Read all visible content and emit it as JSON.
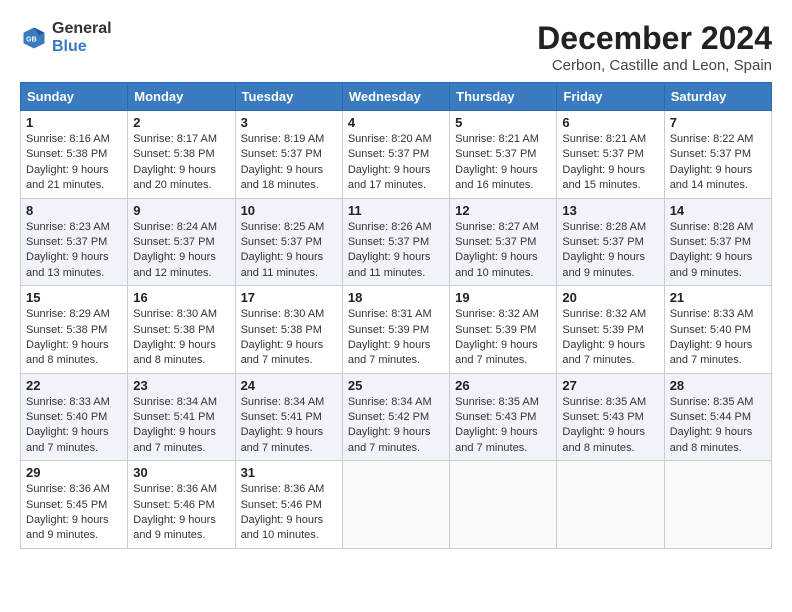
{
  "header": {
    "logo": {
      "line1": "General",
      "line2": "Blue"
    },
    "title": "December 2024",
    "subtitle": "Cerbon, Castille and Leon, Spain"
  },
  "weekdays": [
    "Sunday",
    "Monday",
    "Tuesday",
    "Wednesday",
    "Thursday",
    "Friday",
    "Saturday"
  ],
  "weeks": [
    [
      {
        "day": "1",
        "info": "Sunrise: 8:16 AM\nSunset: 5:38 PM\nDaylight: 9 hours\nand 21 minutes."
      },
      {
        "day": "2",
        "info": "Sunrise: 8:17 AM\nSunset: 5:38 PM\nDaylight: 9 hours\nand 20 minutes."
      },
      {
        "day": "3",
        "info": "Sunrise: 8:19 AM\nSunset: 5:37 PM\nDaylight: 9 hours\nand 18 minutes."
      },
      {
        "day": "4",
        "info": "Sunrise: 8:20 AM\nSunset: 5:37 PM\nDaylight: 9 hours\nand 17 minutes."
      },
      {
        "day": "5",
        "info": "Sunrise: 8:21 AM\nSunset: 5:37 PM\nDaylight: 9 hours\nand 16 minutes."
      },
      {
        "day": "6",
        "info": "Sunrise: 8:21 AM\nSunset: 5:37 PM\nDaylight: 9 hours\nand 15 minutes."
      },
      {
        "day": "7",
        "info": "Sunrise: 8:22 AM\nSunset: 5:37 PM\nDaylight: 9 hours\nand 14 minutes."
      }
    ],
    [
      {
        "day": "8",
        "info": "Sunrise: 8:23 AM\nSunset: 5:37 PM\nDaylight: 9 hours\nand 13 minutes."
      },
      {
        "day": "9",
        "info": "Sunrise: 8:24 AM\nSunset: 5:37 PM\nDaylight: 9 hours\nand 12 minutes."
      },
      {
        "day": "10",
        "info": "Sunrise: 8:25 AM\nSunset: 5:37 PM\nDaylight: 9 hours\nand 11 minutes."
      },
      {
        "day": "11",
        "info": "Sunrise: 8:26 AM\nSunset: 5:37 PM\nDaylight: 9 hours\nand 11 minutes."
      },
      {
        "day": "12",
        "info": "Sunrise: 8:27 AM\nSunset: 5:37 PM\nDaylight: 9 hours\nand 10 minutes."
      },
      {
        "day": "13",
        "info": "Sunrise: 8:28 AM\nSunset: 5:37 PM\nDaylight: 9 hours\nand 9 minutes."
      },
      {
        "day": "14",
        "info": "Sunrise: 8:28 AM\nSunset: 5:37 PM\nDaylight: 9 hours\nand 9 minutes."
      }
    ],
    [
      {
        "day": "15",
        "info": "Sunrise: 8:29 AM\nSunset: 5:38 PM\nDaylight: 9 hours\nand 8 minutes."
      },
      {
        "day": "16",
        "info": "Sunrise: 8:30 AM\nSunset: 5:38 PM\nDaylight: 9 hours\nand 8 minutes."
      },
      {
        "day": "17",
        "info": "Sunrise: 8:30 AM\nSunset: 5:38 PM\nDaylight: 9 hours\nand 7 minutes."
      },
      {
        "day": "18",
        "info": "Sunrise: 8:31 AM\nSunset: 5:39 PM\nDaylight: 9 hours\nand 7 minutes."
      },
      {
        "day": "19",
        "info": "Sunrise: 8:32 AM\nSunset: 5:39 PM\nDaylight: 9 hours\nand 7 minutes."
      },
      {
        "day": "20",
        "info": "Sunrise: 8:32 AM\nSunset: 5:39 PM\nDaylight: 9 hours\nand 7 minutes."
      },
      {
        "day": "21",
        "info": "Sunrise: 8:33 AM\nSunset: 5:40 PM\nDaylight: 9 hours\nand 7 minutes."
      }
    ],
    [
      {
        "day": "22",
        "info": "Sunrise: 8:33 AM\nSunset: 5:40 PM\nDaylight: 9 hours\nand 7 minutes."
      },
      {
        "day": "23",
        "info": "Sunrise: 8:34 AM\nSunset: 5:41 PM\nDaylight: 9 hours\nand 7 minutes."
      },
      {
        "day": "24",
        "info": "Sunrise: 8:34 AM\nSunset: 5:41 PM\nDaylight: 9 hours\nand 7 minutes."
      },
      {
        "day": "25",
        "info": "Sunrise: 8:34 AM\nSunset: 5:42 PM\nDaylight: 9 hours\nand 7 minutes."
      },
      {
        "day": "26",
        "info": "Sunrise: 8:35 AM\nSunset: 5:43 PM\nDaylight: 9 hours\nand 7 minutes."
      },
      {
        "day": "27",
        "info": "Sunrise: 8:35 AM\nSunset: 5:43 PM\nDaylight: 9 hours\nand 8 minutes."
      },
      {
        "day": "28",
        "info": "Sunrise: 8:35 AM\nSunset: 5:44 PM\nDaylight: 9 hours\nand 8 minutes."
      }
    ],
    [
      {
        "day": "29",
        "info": "Sunrise: 8:36 AM\nSunset: 5:45 PM\nDaylight: 9 hours\nand 9 minutes."
      },
      {
        "day": "30",
        "info": "Sunrise: 8:36 AM\nSunset: 5:46 PM\nDaylight: 9 hours\nand 9 minutes."
      },
      {
        "day": "31",
        "info": "Sunrise: 8:36 AM\nSunset: 5:46 PM\nDaylight: 9 hours\nand 10 minutes."
      },
      {
        "day": "",
        "info": ""
      },
      {
        "day": "",
        "info": ""
      },
      {
        "day": "",
        "info": ""
      },
      {
        "day": "",
        "info": ""
      }
    ]
  ]
}
